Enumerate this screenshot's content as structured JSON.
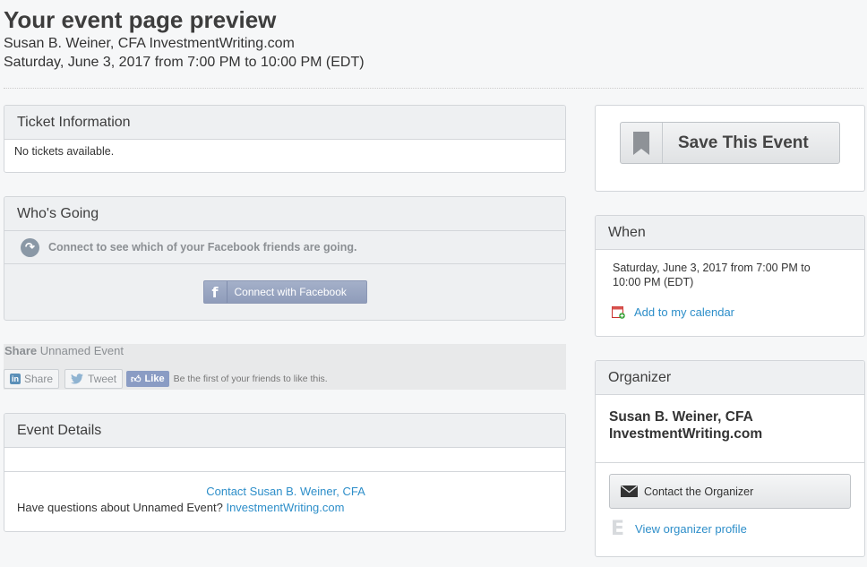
{
  "header": {
    "title": "Your event page preview",
    "organizer_line": "Susan B. Weiner, CFA InvestmentWriting.com",
    "date_line": "Saturday, June 3, 2017 from 7:00 PM to 10:00 PM (EDT)"
  },
  "tickets": {
    "heading": "Ticket Information",
    "message": "No tickets available."
  },
  "whos_going": {
    "heading": "Who's Going",
    "connect_prompt": "Connect to see which of your Facebook friends are going.",
    "connect_button": "Connect with Facebook",
    "fb_glyph": "f"
  },
  "share": {
    "label": "Share",
    "event_name": "Unnamed Event",
    "linkedin_label": "Share",
    "linkedin_glyph": "in",
    "tweet_label": "Tweet",
    "like_label": "Like",
    "like_text": "Be the first of your friends to like this."
  },
  "details": {
    "heading": "Event Details",
    "contact_link": "Contact Susan B. Weiner, CFA",
    "question_prefix": "Have questions about Unnamed Event?",
    "question_link": "InvestmentWriting.com"
  },
  "save": {
    "label": "Save This Event"
  },
  "when": {
    "heading": "When",
    "date_line1": "Saturday, June 3, 2017 from 7:00 PM to",
    "date_line2": "10:00 PM (EDT)",
    "calendar_link": "Add to my calendar"
  },
  "organizer": {
    "heading": "Organizer",
    "name_line1": "Susan B. Weiner, CFA",
    "name_line2": "InvestmentWriting.com",
    "contact_button": "Contact the Organizer",
    "profile_link": "View organizer profile",
    "eventbrite_glyph": "E"
  },
  "colors": {
    "link": "#2d8ec9",
    "panel_head": "#eef0f2",
    "facebook": "#8f9cba"
  }
}
